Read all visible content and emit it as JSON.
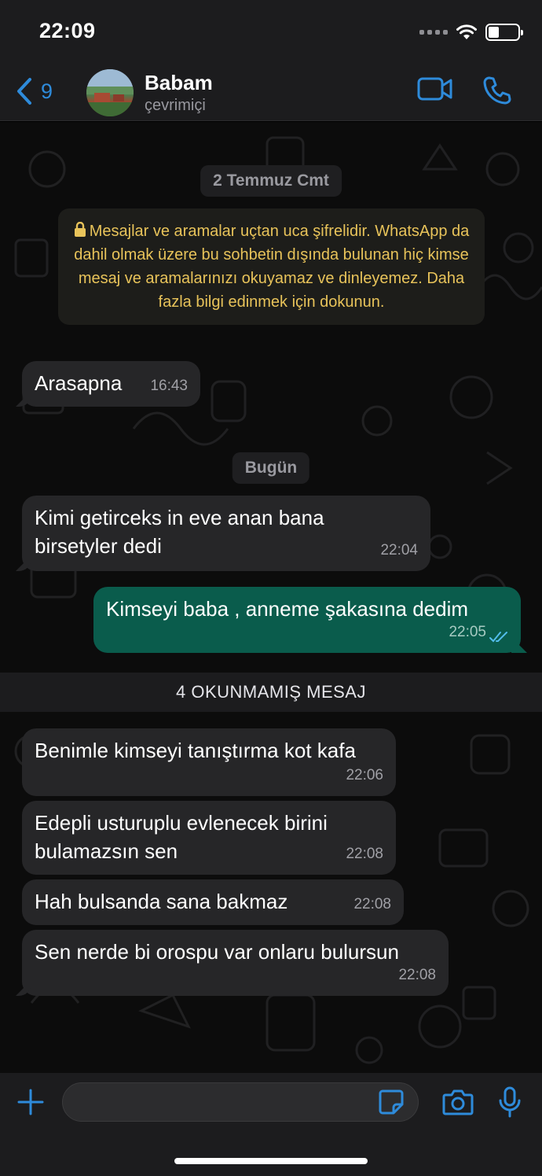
{
  "status_bar": {
    "time": "22:09",
    "battery_level": 0.35
  },
  "header": {
    "back_count": "9",
    "contact_name": "Babam",
    "contact_status": "çevrimiçi",
    "icons": [
      "chevron-left-icon",
      "video-call-icon",
      "phone-icon"
    ],
    "accent_color": "#2e8bdb"
  },
  "chat": {
    "date_1": "2 Temmuz Cmt",
    "encryption_notice": {
      "icon": "lock-icon",
      "text": "Mesajlar ve aramalar uçtan uca şifrelidir. WhatsApp da dahil olmak üzere bu sohbetin dışında bulunan hiç kimse mesaj ve aramalarınızı okuyamaz ve dinleyemez. Daha fazla bilgi edinmek için dokunun."
    },
    "date_2": "Bugün",
    "unread_label": "4 OKUNMAMIŞ MESAJ",
    "messages": [
      {
        "direction": "in",
        "text": "Arasapna",
        "time": "16:43"
      },
      {
        "direction": "in",
        "text": "Kimi getirceks in eve anan bana birsetyler dedi",
        "time": "22:04"
      },
      {
        "direction": "out",
        "text": "Kimseyi baba , anneme şakasına dedim",
        "time": "22:05",
        "read": true
      },
      {
        "direction": "in",
        "text": "Benimle kimseyi tanıştırma kot kafa",
        "time": "22:06"
      },
      {
        "direction": "in",
        "text": "Edepli usturuplu evlenecek birini bulamazsın sen",
        "time": "22:08"
      },
      {
        "direction": "in",
        "text": "Hah bulsanda sana bakmaz",
        "time": "22:08"
      },
      {
        "direction": "in",
        "text": "Sen nerde bi orospu var onlaru bulursun",
        "time": "22:08"
      }
    ],
    "colors": {
      "incoming": "#262628",
      "outgoing": "#0a5c4c",
      "notice_text": "#e8c35a",
      "read_receipt": "#53bdeb"
    }
  },
  "input_bar": {
    "placeholder": "",
    "icons": [
      "plus-icon",
      "sticker-icon",
      "camera-icon",
      "microphone-icon"
    ]
  }
}
